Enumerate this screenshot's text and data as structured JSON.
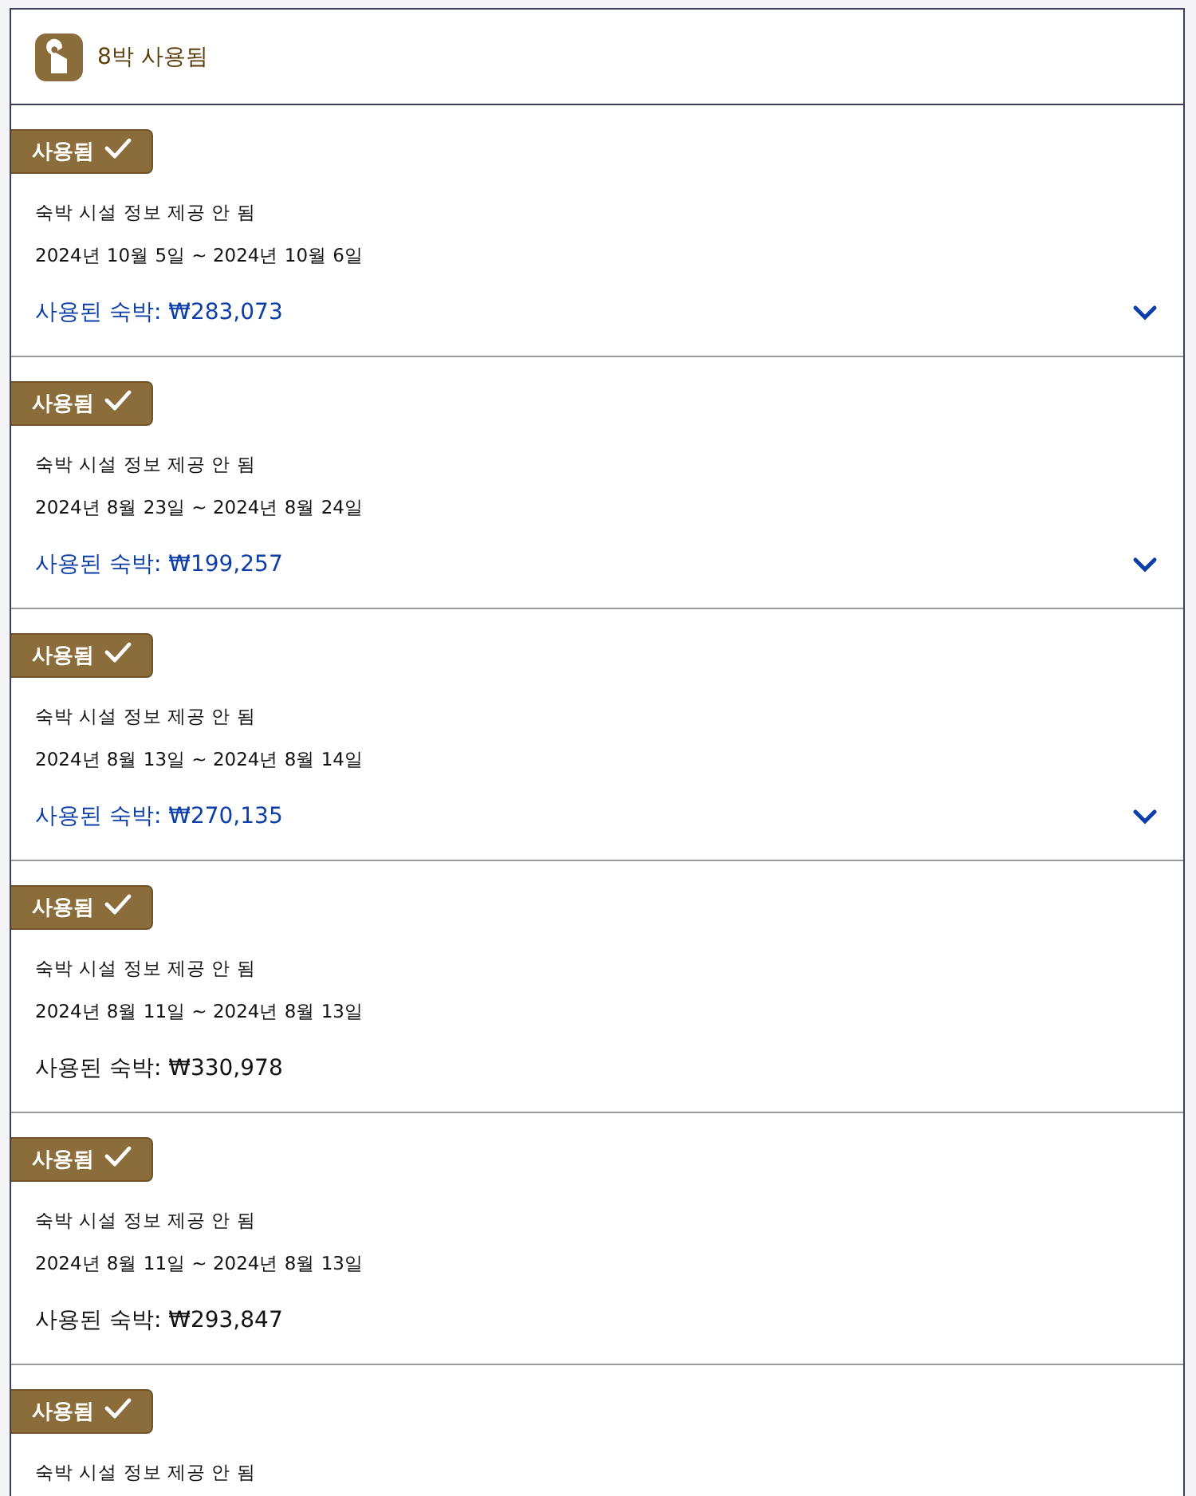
{
  "header": {
    "title": "8박 사용됨"
  },
  "stays": [
    {
      "badge": "사용됨",
      "property": "숙박 시설 정보 제공 안 됨",
      "dates": "2024년 10월 5일 ~ 2024년 10월 6일",
      "price": "사용된 숙박: ₩283,073",
      "kind": "expandable"
    },
    {
      "badge": "사용됨",
      "property": "숙박 시설 정보 제공 안 됨",
      "dates": "2024년 8월 23일 ~ 2024년 8월 24일",
      "price": "사용된 숙박: ₩199,257",
      "kind": "expandable"
    },
    {
      "badge": "사용됨",
      "property": "숙박 시설 정보 제공 안 됨",
      "dates": "2024년 8월 13일 ~ 2024년 8월 14일",
      "price": "사용된 숙박: ₩270,135",
      "kind": "expandable"
    },
    {
      "badge": "사용됨",
      "property": "숙박 시설 정보 제공 안 됨",
      "dates": "2024년 8월 11일 ~ 2024년 8월 13일",
      "price": "사용된 숙박: ₩330,978",
      "kind": "plain"
    },
    {
      "badge": "사용됨",
      "property": "숙박 시설 정보 제공 안 됨",
      "dates": "2024년 8월 11일 ~ 2024년 8월 13일",
      "price": "사용된 숙박: ₩293,847",
      "kind": "plain"
    },
    {
      "badge": "사용됨",
      "property": "숙박 시설 정보 제공 안 됨"
    }
  ]
}
